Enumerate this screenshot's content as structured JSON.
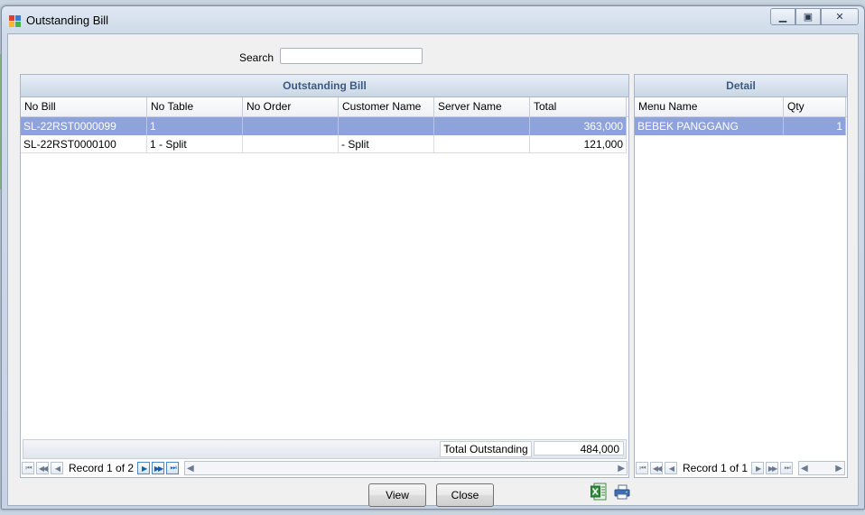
{
  "window": {
    "title": "Outstanding Bill"
  },
  "search": {
    "label": "Search",
    "value": ""
  },
  "bill_panel": {
    "title": "Outstanding Bill",
    "columns": [
      "No Bill",
      "No Table",
      "No Order",
      "Customer Name",
      "Server Name",
      "Total"
    ],
    "rows": [
      {
        "no_bill": "SL-22RST0000099",
        "no_table": "1",
        "no_order": "",
        "customer": "",
        "server": "",
        "total": "363,000",
        "selected": true
      },
      {
        "no_bill": "SL-22RST0000100",
        "no_table": "1 - Split",
        "no_order": "",
        "customer": " - Split",
        "server": "",
        "total": "121,000",
        "selected": false
      }
    ],
    "total_label": "Total Outstanding",
    "total_value": "484,000",
    "record_text": "Record 1 of 2"
  },
  "detail_panel": {
    "title": "Detail",
    "columns": [
      "Menu Name",
      "Qty"
    ],
    "rows": [
      {
        "menu": "BEBEK PANGGANG",
        "qty": "1",
        "selected": true
      }
    ],
    "record_text": "Record 1 of 1"
  },
  "buttons": {
    "view": "View",
    "close": "Close"
  },
  "icons": {
    "app": "app-icon",
    "excel": "excel-icon",
    "print": "printer-icon"
  }
}
